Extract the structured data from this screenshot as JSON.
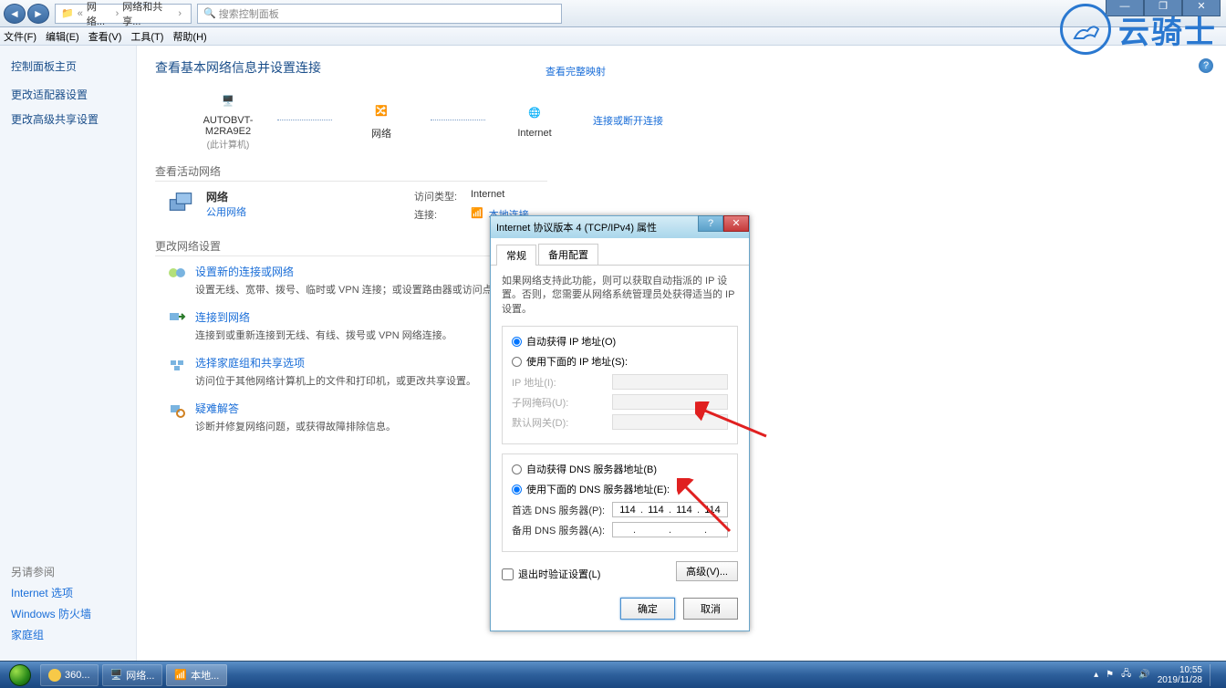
{
  "window": {
    "breadcrumb": {
      "part1": "网络...",
      "part2": "网络和共享..."
    },
    "search_placeholder": "搜索控制面板",
    "minimize": "—",
    "maximize": "❐",
    "close": "✕"
  },
  "menu": {
    "file": "文件(F)",
    "edit": "编辑(E)",
    "view": "查看(V)",
    "tools": "工具(T)",
    "help": "帮助(H)"
  },
  "sidebar": {
    "home": "控制面板主页",
    "items": [
      "更改适配器设置",
      "更改高级共享设置"
    ]
  },
  "main": {
    "title": "查看基本网络信息并设置连接",
    "see_full_map": "查看完整映射",
    "nodes": {
      "pc": "AUTOBVT-M2RA9E2",
      "pc_sub": "(此计算机)",
      "net": "网络",
      "inet": "Internet"
    },
    "active_section": "查看活动网络",
    "conn_disc": "连接或断开连接",
    "active": {
      "name": "网络",
      "type": "公用网络",
      "access_lbl": "访问类型:",
      "access_val": "Internet",
      "conn_lbl": "连接:",
      "conn_val": "本地连接"
    },
    "change_section": "更改网络设置",
    "settings": [
      {
        "title": "设置新的连接或网络",
        "desc": "设置无线、宽带、拨号、临时或 VPN 连接；或设置路由器或访问点。"
      },
      {
        "title": "连接到网络",
        "desc": "连接到或重新连接到无线、有线、拨号或 VPN 网络连接。"
      },
      {
        "title": "选择家庭组和共享选项",
        "desc": "访问位于其他网络计算机上的文件和打印机，或更改共享设置。"
      },
      {
        "title": "疑难解答",
        "desc": "诊断并修复网络问题，或获得故障排除信息。"
      }
    ]
  },
  "see_also": {
    "header": "另请参阅",
    "links": [
      "Internet 选项",
      "Windows 防火墙",
      "家庭组"
    ]
  },
  "dialog": {
    "title": "Internet 协议版本 4 (TCP/IPv4) 属性",
    "help": "?",
    "close": "✕",
    "tabs": [
      "常规",
      "备用配置"
    ],
    "desc": "如果网络支持此功能，则可以获取自动指派的 IP 设置。否则，您需要从网络系统管理员处获得适当的 IP 设置。",
    "ip_auto": "自动获得 IP 地址(O)",
    "ip_manual": "使用下面的 IP 地址(S):",
    "ip_addr": "IP 地址(I):",
    "subnet": "子网掩码(U):",
    "gateway": "默认网关(D):",
    "dns_auto": "自动获得 DNS 服务器地址(B)",
    "dns_manual": "使用下面的 DNS 服务器地址(E):",
    "dns_pref": "首选 DNS 服务器(P):",
    "dns_alt": "备用 DNS 服务器(A):",
    "dns_pref_val": [
      "114",
      "114",
      "114",
      "114"
    ],
    "validate": "退出时验证设置(L)",
    "advanced": "高级(V)...",
    "ok": "确定",
    "cancel": "取消"
  },
  "watermark": {
    "text": "云骑士"
  },
  "taskbar": {
    "items": [
      "360...",
      "网络...",
      "本地..."
    ],
    "time": "10:55",
    "date": "2019/11/28"
  }
}
